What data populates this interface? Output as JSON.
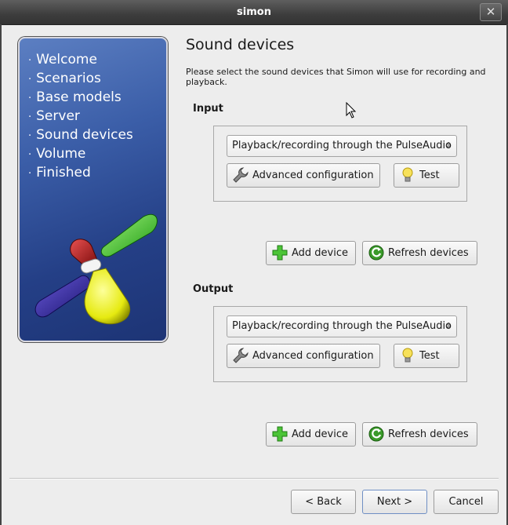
{
  "window": {
    "title": "simon",
    "close_glyph": "✕"
  },
  "sidebar": {
    "bullet": "·",
    "items": [
      {
        "label": "Welcome"
      },
      {
        "label": "Scenarios"
      },
      {
        "label": "Base models"
      },
      {
        "label": "Server"
      },
      {
        "label": "Sound devices"
      },
      {
        "label": "Volume"
      },
      {
        "label": "Finished"
      }
    ]
  },
  "page": {
    "title": "Sound devices",
    "description": "Please select the sound devices that Simon will use for recording and playback."
  },
  "input": {
    "label": "Input",
    "device_value": "Playback/recording through the PulseAudio",
    "advanced_label": "Advanced configuration",
    "test_label": "Test",
    "add_label": "Add device",
    "refresh_label": "Refresh devices"
  },
  "output": {
    "label": "Output",
    "device_value": "Playback/recording through the PulseAudio",
    "advanced_label": "Advanced configuration",
    "test_label": "Test",
    "add_label": "Add device",
    "refresh_label": "Refresh devices"
  },
  "footer": {
    "back_label": "< Back",
    "next_label": "Next >",
    "cancel_label": "Cancel"
  },
  "icons": {
    "wrench": "wrench-icon",
    "bulb": "lightbulb-icon",
    "add": "plus-icon",
    "refresh": "refresh-icon"
  }
}
